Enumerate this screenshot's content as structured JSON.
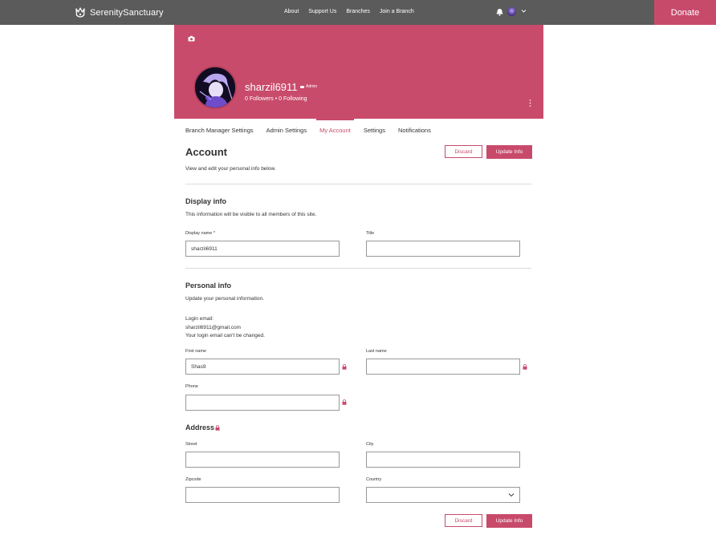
{
  "brand": {
    "name": "SerenitySanctuary",
    "accent": "#c84a6b",
    "nav_bg": "#5b5b5b"
  },
  "nav": {
    "items": [
      "About",
      "Support Us",
      "Branches",
      "Join a Branch"
    ],
    "donate_label": "Donate"
  },
  "profile": {
    "username": "sharzil6911",
    "role": "Admin",
    "follow_text": "0 Followers • 0 Following"
  },
  "tabs": [
    "Branch Manager Settings",
    "Admin Settings",
    "My Account",
    "Settings",
    "Notifications"
  ],
  "account": {
    "title": "Account",
    "subtitle": "View and edit your personal info below.",
    "discard_label": "Discard",
    "update_label": "Update Info"
  },
  "display_info": {
    "title": "Display info",
    "subtitle": "This information will be visible to all members of this site.",
    "display_name_label": "Display name *",
    "display_name_value": "sharzil6911",
    "title_label": "Title",
    "title_value": ""
  },
  "personal_info": {
    "title": "Personal info",
    "subtitle": "Update your personal information.",
    "login_email_label": "Login email:",
    "login_email_value": "sharzil6911@gmail.com",
    "login_email_note": "Your login email can't be changed.",
    "first_name_label": "First name",
    "first_name_value": "Shas9",
    "last_name_label": "Last name",
    "last_name_value": "",
    "phone_label": "Phone",
    "phone_value": ""
  },
  "address": {
    "title": "Address",
    "street_label": "Street",
    "city_label": "City",
    "zipcode_label": "Zipcode",
    "country_label": "Country"
  },
  "icons": [
    "crown-logo-icon",
    "bell-icon",
    "chevron-down-icon",
    "camera-icon",
    "more-vertical-icon",
    "lock-icon",
    "admin-badge-icon"
  ]
}
